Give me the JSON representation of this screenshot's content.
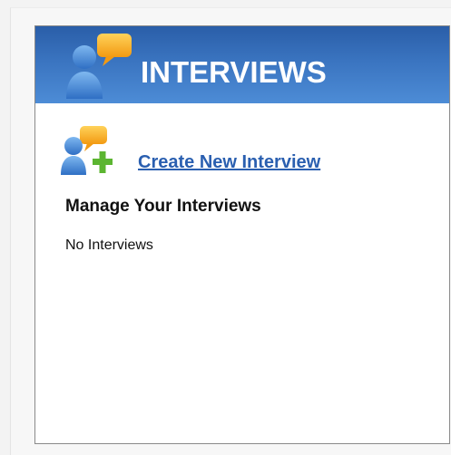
{
  "header": {
    "title": "INTERVIEWS",
    "icon": "interview-people-icon"
  },
  "actions": {
    "create_label": "Create New Interview",
    "create_icon": "add-person-icon"
  },
  "manage": {
    "heading": "Manage Your Interviews",
    "empty_message": "No Interviews"
  },
  "colors": {
    "header_blue": "#3a74c0",
    "link_blue": "#2a5fb0",
    "person_blue": "#3b82d6",
    "bubble_orange": "#f5a623",
    "plus_green": "#5cb531"
  }
}
